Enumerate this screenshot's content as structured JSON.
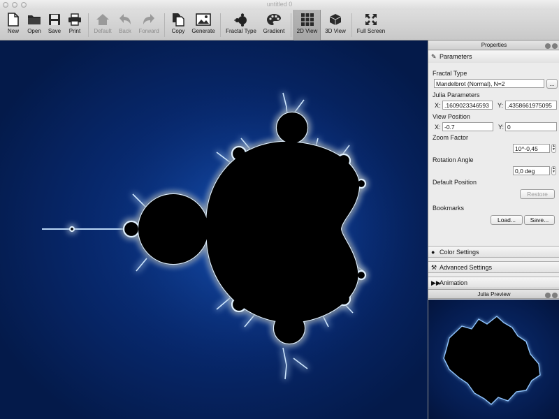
{
  "window": {
    "title": "untitled 0"
  },
  "toolbar": {
    "new": "New",
    "open": "Open",
    "save": "Save",
    "print": "Print",
    "default": "Default",
    "back": "Back",
    "forward": "Forward",
    "copy": "Copy",
    "generate": "Generate",
    "fractal_type": "Fractal Type",
    "gradient": "Gradient",
    "view2d": "2D View",
    "view3d": "3D View",
    "fullscreen": "Full Screen"
  },
  "panel": {
    "title": "Properties",
    "parameters": "Parameters",
    "fractal_type_label": "Fractal Type",
    "fractal_type_value": "Mandelbrot (Normal), N=2",
    "more_button": "...",
    "julia_label": "Julia Parameters",
    "julia_x_label": "X:",
    "julia_x_value": ".1609023346593",
    "julia_y_label": "Y:",
    "julia_y_value": ".4358661975095",
    "view_position_label": "View Position",
    "view_x_label": "X:",
    "view_x_value": "-0.7",
    "view_y_label": "Y:",
    "view_y_value": "0",
    "zoom_label": "Zoom Factor",
    "zoom_value": "10^-0,45",
    "rotation_label": "Rotation Angle",
    "rotation_value": "0,0 deg",
    "default_position_label": "Default Position",
    "restore_button": "Restore",
    "bookmarks_label": "Bookmarks",
    "load_button": "Load...",
    "save_button": "Save...",
    "color_settings": "Color Settings",
    "advanced_settings": "Advanced Settings",
    "animation": "Animation"
  },
  "preview": {
    "title": "Julia Preview"
  }
}
